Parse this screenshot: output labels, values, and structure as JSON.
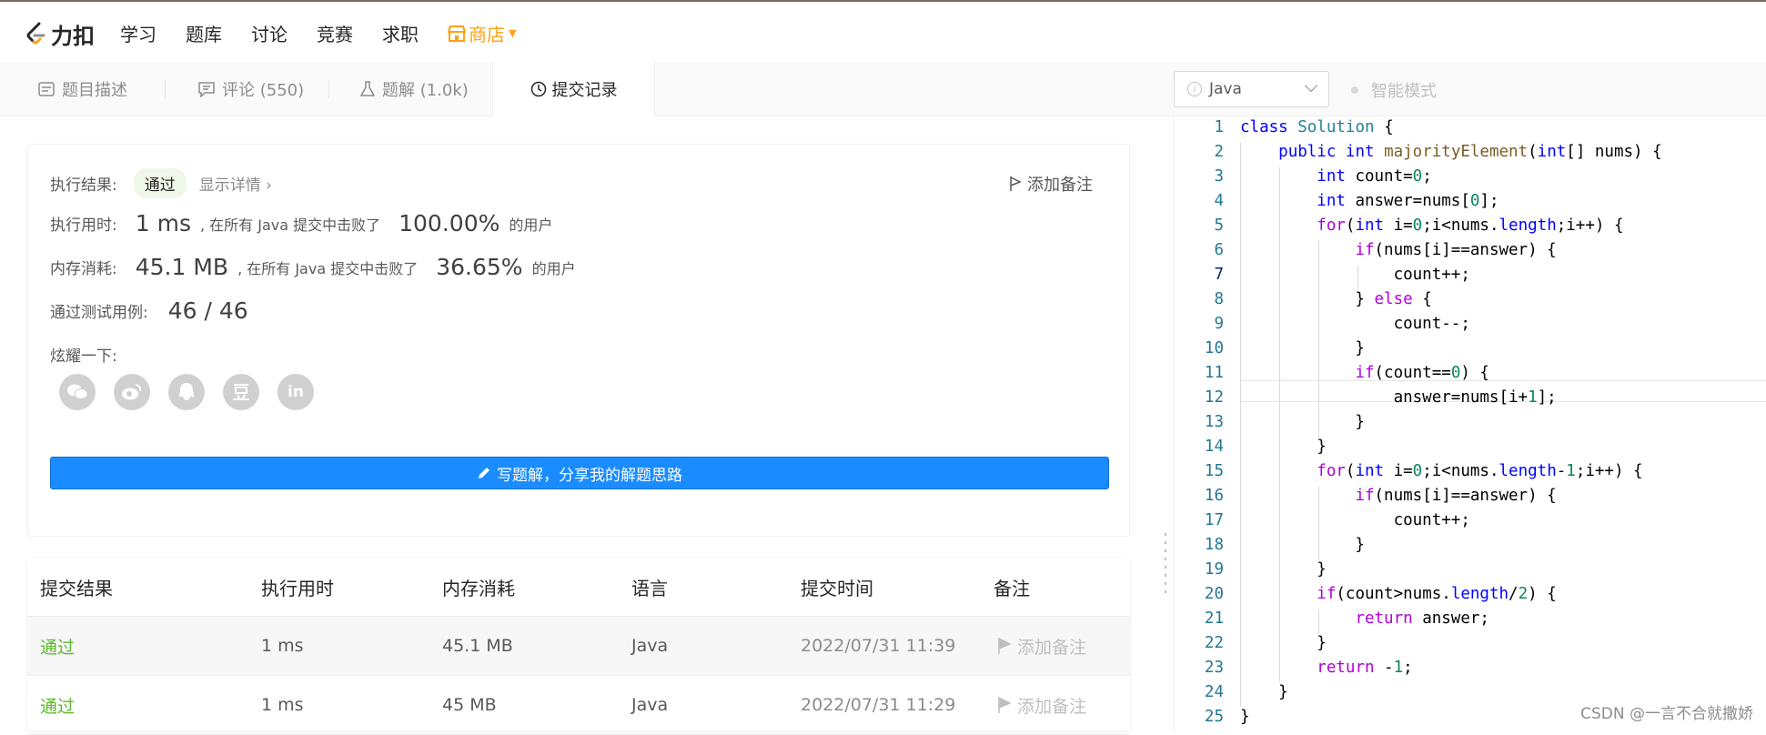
{
  "nav": {
    "logo_text": "力扣",
    "items": [
      "学习",
      "题库",
      "讨论",
      "竞赛",
      "求职"
    ],
    "shop": "商店"
  },
  "tabs": [
    {
      "label": "题目描述"
    },
    {
      "label": "评论 (550)"
    },
    {
      "label": "题解 (1.0k)"
    },
    {
      "label": "提交记录"
    }
  ],
  "editor_bar": {
    "language": "Java",
    "smart_mode": "智能模式"
  },
  "result": {
    "label": "执行结果:",
    "status": "通过",
    "details": "显示详情",
    "add_note": "添加备注",
    "time_label": "执行用时:",
    "time_value": "1 ms",
    "time_mid": ", 在所有 Java 提交中击败了",
    "time_pct": "100.00%",
    "time_suffix": "的用户",
    "mem_label": "内存消耗:",
    "mem_value": "45.1 MB",
    "mem_mid": ", 在所有 Java 提交中击败了",
    "mem_pct": "36.65%",
    "mem_suffix": "的用户",
    "cases_label": "通过测试用例:",
    "cases_value": "46 / 46",
    "share_label": "炫耀一下:",
    "write_btn": "写题解，分享我的解题思路"
  },
  "table": {
    "headers": [
      "提交结果",
      "执行用时",
      "内存消耗",
      "语言",
      "提交时间",
      "备注"
    ],
    "rows": [
      {
        "status": "通过",
        "time": "1 ms",
        "mem": "45.1 MB",
        "lang": "Java",
        "date": "2022/07/31 11:39",
        "note": "添加备注"
      },
      {
        "status": "通过",
        "time": "1 ms",
        "mem": "45 MB",
        "lang": "Java",
        "date": "2022/07/31 11:29",
        "note": "添加备注"
      }
    ]
  },
  "watermark": "CSDN @一言不合就撒娇",
  "colors": {
    "accent": "#1a8cff",
    "success": "#5cb82c",
    "shop": "#ffa116"
  }
}
